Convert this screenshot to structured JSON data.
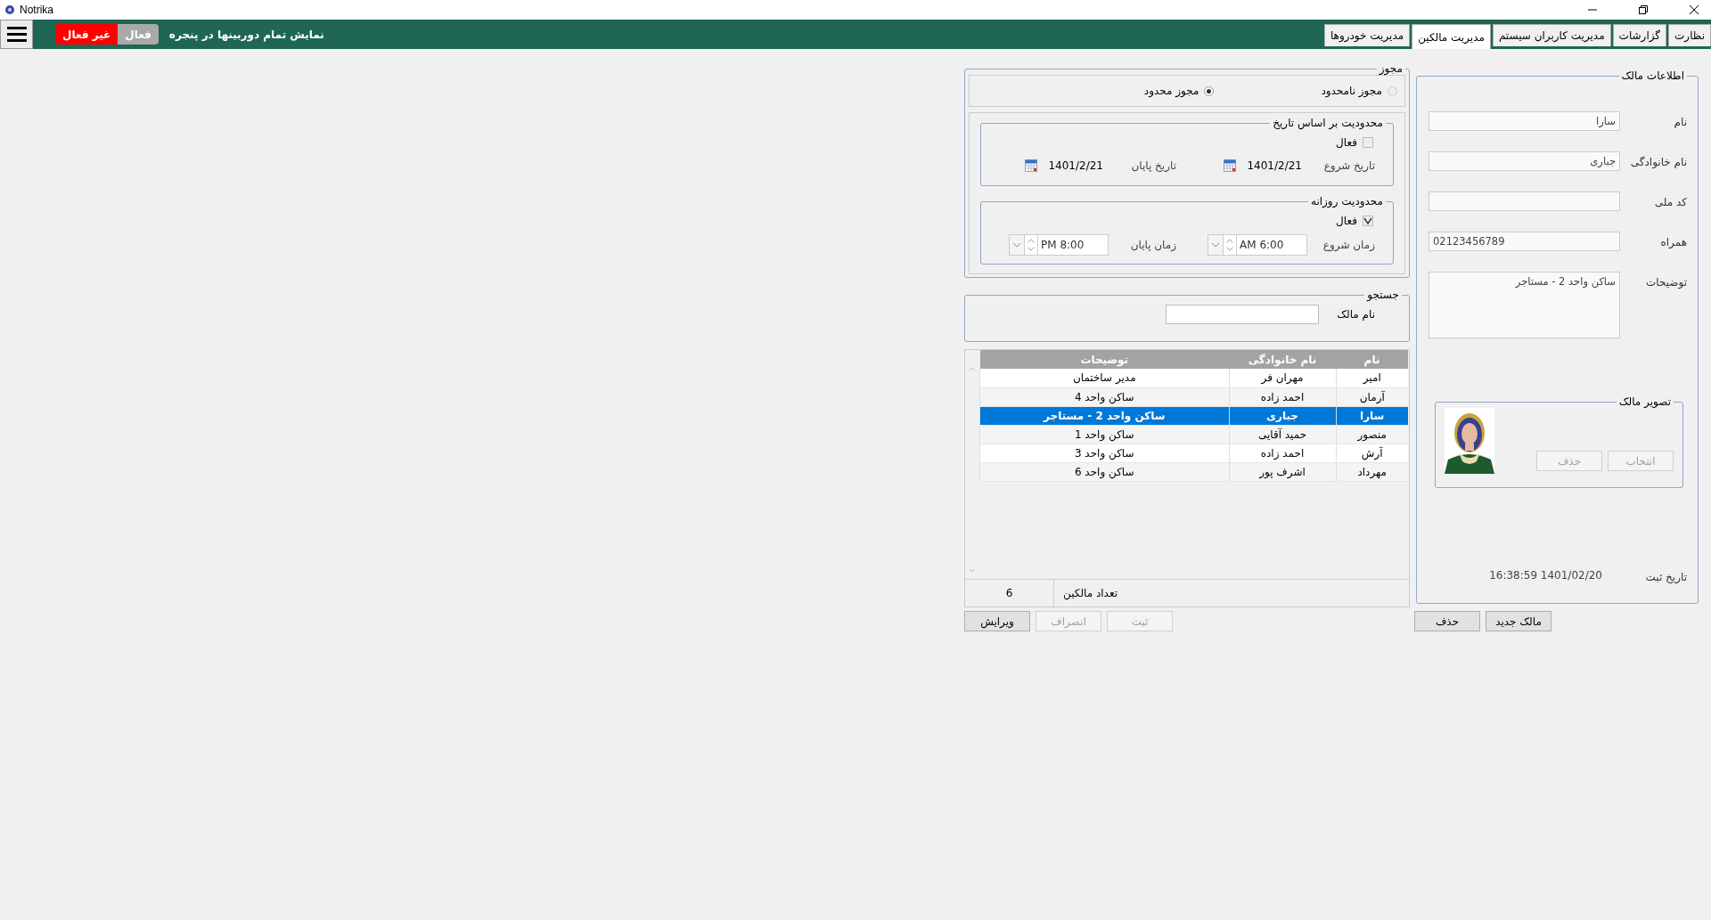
{
  "window": {
    "title": "Notrika"
  },
  "toolbar": {
    "show_all_label": "نمایش تمام دوربینها در پنجره",
    "toggle": [
      {
        "label": "فعال",
        "selected": false
      },
      {
        "label": "غیر فعال",
        "selected": true
      }
    ]
  },
  "tabs": [
    {
      "label": "نظارت",
      "selected": false
    },
    {
      "label": "گزارشات",
      "selected": false
    },
    {
      "label": "مدیریت کاربران سیستم",
      "selected": false
    },
    {
      "label": "مدیریت مالکین",
      "selected": true
    },
    {
      "label": "مدیریت خودروها",
      "selected": false
    }
  ],
  "owner_info": {
    "title": "اطلاعات مالک",
    "fields": [
      {
        "label": "نام",
        "value": "سارا",
        "kind": "text"
      },
      {
        "label": "نام خانوادگی",
        "value": "جباری",
        "kind": "text"
      },
      {
        "label": "کد ملی",
        "kind": "text"
      },
      {
        "label": "همراه",
        "value": "02123456789",
        "kind": "text"
      },
      {
        "label": "توضیحات",
        "value": "ساکن واحد 2 - مستاجر",
        "kind": "multiline"
      }
    ],
    "photo": {
      "title": "تصویر مالک",
      "buttons": [
        {
          "label": "انتخاب",
          "disabled": true
        },
        {
          "label": "حذف",
          "disabled": true
        }
      ]
    },
    "registered": {
      "label": "تاریخ ثبت",
      "value": "16:38:59 1401/02/20"
    }
  },
  "owner_buttons": [
    {
      "label": "مالک جدید",
      "disabled": false
    },
    {
      "label": "حذف",
      "disabled": false
    }
  ],
  "permit": {
    "title": "مجوز",
    "options": [
      {
        "label": "مجوز نامحدود",
        "selected": false
      },
      {
        "label": "مجوز محدود",
        "selected": true
      }
    ],
    "date_limit": {
      "title": "محدودیت بر اساس تاریخ",
      "active": {
        "label": "فعال",
        "checked": false
      },
      "start": {
        "label": "تاریخ شروع",
        "value": "1401/2/21"
      },
      "end": {
        "label": "تاریخ پایان",
        "value": "1401/2/21"
      }
    },
    "daily_limit": {
      "title": "محدودیت روزانه",
      "active": {
        "label": "فعال",
        "checked": true
      },
      "start": {
        "label": "زمان شروع",
        "value": "AM 6:00"
      },
      "end": {
        "label": "زمان پایان",
        "value": "PM 8:00"
      }
    }
  },
  "search": {
    "title": "جستجو",
    "label": "نام مالک"
  },
  "grid": {
    "columns": [
      "نام",
      "نام خانوادگی",
      "توضیحات"
    ],
    "rows": [
      {
        "cells": [
          "امیر",
          "مهران فر",
          "مدیر ساختمان"
        ],
        "selected": false
      },
      {
        "cells": [
          "آرمان",
          "احمد زاده",
          "ساکن واحد 4"
        ],
        "selected": false
      },
      {
        "cells": [
          "سارا",
          "جباری",
          "ساکن واحد 2 - مستاجر"
        ],
        "selected": true
      },
      {
        "cells": [
          "منصور",
          "حمید آقایی",
          "ساکن واحد 1"
        ],
        "selected": false
      },
      {
        "cells": [
          "آرش",
          "احمد زاده",
          "ساکن واحد 3"
        ],
        "selected": false
      },
      {
        "cells": [
          "مهرداد",
          "اشرف پور",
          "ساکن واحد 6"
        ],
        "selected": false
      }
    ],
    "footer": {
      "label": "تعداد مالکین",
      "value": "6"
    }
  },
  "form_buttons": [
    {
      "label": "ثبت",
      "disabled": true
    },
    {
      "label": "انصراف",
      "disabled": true
    },
    {
      "label": "ویرایش",
      "disabled": false
    }
  ]
}
